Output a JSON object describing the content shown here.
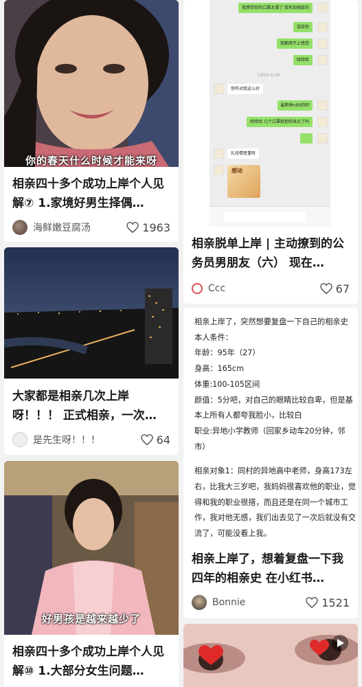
{
  "feed": {
    "card1": {
      "caption": "你的春天什么时候才能来呀",
      "title": "相亲四十多个成功上岸个人见解⑦ 1.家境好男生择偶…",
      "author": "海鲜嫩豆腐汤",
      "likes": "1963"
    },
    "card2": {
      "title": "大家都是相亲几次上岸呀！！！ 正式相亲，一次…",
      "author": "是先生呀！！！",
      "likes": "64"
    },
    "card3": {
      "caption": "好男孩是越来越少了",
      "title": "相亲四十多个成功上岸个人见解⑩ 1.大部分女生问题…"
    },
    "card4": {
      "chat": {
        "messages": [
          {
            "side": "right",
            "text": "我感觉你的口罩太薄了 我有加强厚的"
          },
          {
            "side": "right",
            "text": "送给你"
          },
          {
            "side": "right",
            "text": "我都用不上感觉"
          },
          {
            "side": "right",
            "text": "哈哈哈"
          },
          {
            "side": "time",
            "text": "1月5日 22:08"
          },
          {
            "side": "left",
            "text": "你咋对我这么好"
          },
          {
            "side": "right",
            "text": "最新种n95的吧"
          },
          {
            "side": "right",
            "text": "哈哈哈 几个口罩就把你收买了吗"
          },
          {
            "side": "left",
            "text": "礼轻情意重呀"
          },
          {
            "side": "left-sticker",
            "text": "感动"
          }
        ]
      },
      "title": "相亲脱单上岸 | 主动撩到的公务员男朋友（六） 现在…",
      "author": "Ccc",
      "likes": "67"
    },
    "card5": {
      "doc": {
        "intro": "相亲上岸了，突然想要复盘一下自己的相亲史",
        "conditions_heading": "本人条件：",
        "age": "年龄：95年（27）",
        "height": "身高：165cm",
        "weight": "体重:100-105区间",
        "looks": "颜值：5分吧，对自己的眼睛比较自卑，但是基本上所有人都夸我脸小，比较白",
        "job": "职业:异地小学教师（回家乡动车20分钟，邻市）",
        "match1": "相亲对象1：同村的异地高中老师，身高173左右，比我大三岁吧，我妈妈很喜欢他的职业，觉得和我的职业很搭，而且还是在同一个城市工作，我对他无感，我们出去见了一次后就没有交流了，可能没看上我。"
      },
      "title": "相亲上岸了，想着复盘一下我四年的相亲史 在小红书…",
      "author": "Bonnie",
      "likes": "1521"
    }
  },
  "colors": {
    "page_bg": "#f2f2f2",
    "card_bg": "#ffffff",
    "chat_green": "#95e06a"
  }
}
